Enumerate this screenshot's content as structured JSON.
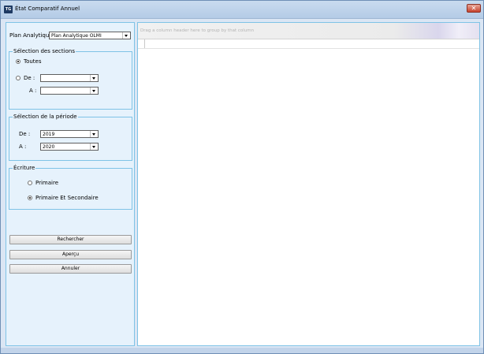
{
  "window": {
    "title": "État Comparatif Annuel",
    "app_icon": "app-logo-icon",
    "close_glyph": "✕"
  },
  "form": {
    "plan_label": "Plan Analytique :",
    "plan_value": "Plan Analytique OLMI",
    "sections": {
      "legend": "Sélection des sections",
      "option_all": "Toutes",
      "option_range": "De :",
      "to_label": "A :",
      "from_value": "",
      "to_value": ""
    },
    "period": {
      "legend": "Sélection de la période",
      "from_label": "De :",
      "from_value": "2019",
      "to_label": "A :",
      "to_value": "2020"
    },
    "writing": {
      "legend": "Écriture",
      "option_primary": "Primaire",
      "option_both": "Primaire Et Secondaire"
    },
    "buttons": {
      "search": "Rechercher",
      "preview": "Aperçu",
      "cancel": "Annuler"
    }
  },
  "grid": {
    "group_hint": "Drag a column header here to group by that column"
  }
}
